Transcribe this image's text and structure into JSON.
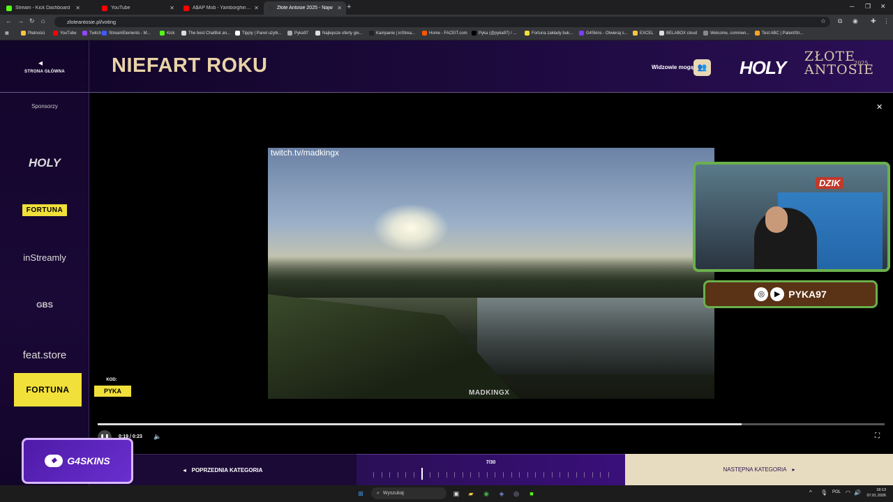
{
  "browser": {
    "tabs": [
      {
        "label": "Stream - Kick Dashboard",
        "color": "#53fc18",
        "active": false
      },
      {
        "label": "YouTube",
        "color": "#ff0000",
        "active": false
      },
      {
        "label": "A$AP Mob - Yamborghini High",
        "color": "#ff0000",
        "active": false
      },
      {
        "label": "Złote Antosie 2025 - Najw",
        "color": "#333333",
        "active": true
      }
    ],
    "url": "zloteantosie.pl/voting",
    "bookmarks": [
      {
        "label": "Płatności",
        "color": "#f5c542"
      },
      {
        "label": "YouTube",
        "color": "#ff0000"
      },
      {
        "label": "Twitch",
        "color": "#9146ff"
      },
      {
        "label": "StreamElements - M...",
        "color": "#3f5bff"
      },
      {
        "label": "Kick",
        "color": "#53fc18"
      },
      {
        "label": "The best ChatBot an...",
        "color": "#dddddd"
      },
      {
        "label": "Tipply | Panel użytk...",
        "color": "#ffffff"
      },
      {
        "label": "Pyka97",
        "color": "#aaaaaa"
      },
      {
        "label": "Najlepsze oferty gie...",
        "color": "#dddddd"
      },
      {
        "label": "Kampanie | inStrea...",
        "color": "#222222"
      },
      {
        "label": "Home - FACEIT.com",
        "color": "#ff5500"
      },
      {
        "label": "Pyka (@pyka97) / ...",
        "color": "#000000"
      },
      {
        "label": "Fortuna zakłady buk...",
        "color": "#f2e03a"
      },
      {
        "label": "G4Skins - Otwieraj s...",
        "color": "#7a3cff"
      },
      {
        "label": "EXCEL",
        "color": "#f5c542"
      },
      {
        "label": "BELABOX cloud",
        "color": "#dddddd"
      },
      {
        "label": "Welcome, commen...",
        "color": "#888888"
      },
      {
        "label": "Test ABC | PatentStr...",
        "color": "#f5a623"
      }
    ]
  },
  "site": {
    "home_label": "STRONA GŁÓWNA",
    "page_title": "NIEFART ROKU",
    "viewers_label": "Widzowie mogą",
    "logo_brand": "HOLY",
    "logo_title_line1": "ZŁOTE",
    "logo_title_line2": "ANTOSIE",
    "logo_year": "2025",
    "sponsors_label": "Sponsorzy",
    "sponsors": [
      "HOLY",
      "FORTUNA",
      "inStreamly",
      "GBS",
      "feat.store"
    ]
  },
  "video": {
    "watermark": "twitch.tv/madkingx",
    "brand": "MADKINGX",
    "time": "0:19 / 0:23",
    "progress": 0.818
  },
  "overlay": {
    "cam_badge": "DZIK",
    "social_handle": "PYKA97",
    "promo_brand": "FORTUNA",
    "kod_label": "KOD:",
    "kod_value": "PYKA",
    "g4_brand": "G4SKINS"
  },
  "footer": {
    "prev_label": "POPRZEDNIA KATEGORIA",
    "count": "7/30",
    "current": 7,
    "total": 30,
    "next_label": "NASTĘPNA KATEGORIA"
  },
  "taskbar": {
    "search_placeholder": "Wyszukaj",
    "lang": "POL",
    "time": "18:13",
    "date": "07.01.2026"
  }
}
